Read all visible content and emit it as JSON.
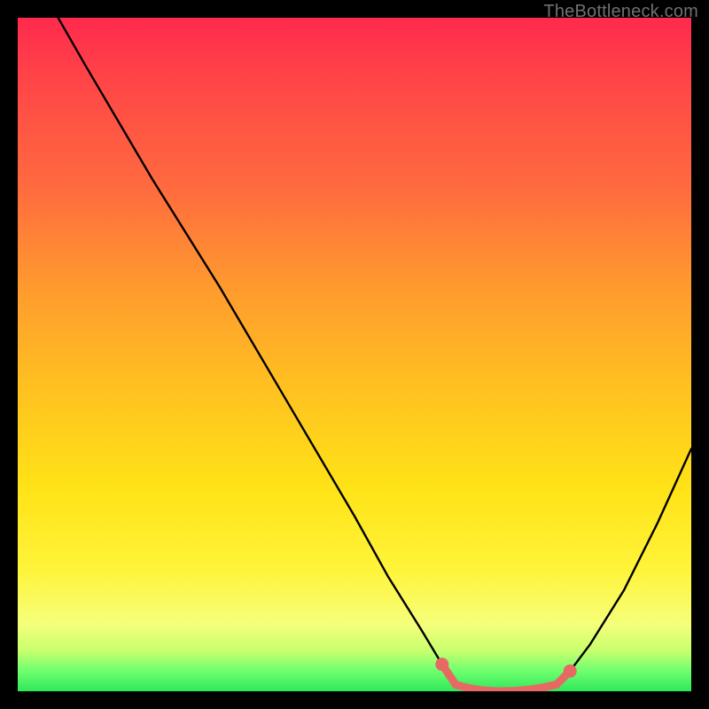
{
  "attribution": "TheBottleneck.com",
  "chart_data": {
    "type": "line",
    "title": "",
    "xlabel": "",
    "ylabel": "",
    "xlim": [
      0,
      100
    ],
    "ylim": [
      0,
      100
    ],
    "background_gradient": {
      "direction": "vertical",
      "stops": [
        {
          "pos": 0,
          "color": "#ff2a4d"
        },
        {
          "pos": 10,
          "color": "#ff4747"
        },
        {
          "pos": 25,
          "color": "#ff6a3f"
        },
        {
          "pos": 40,
          "color": "#ff9a2e"
        },
        {
          "pos": 55,
          "color": "#ffc120"
        },
        {
          "pos": 70,
          "color": "#ffe317"
        },
        {
          "pos": 82,
          "color": "#fff43a"
        },
        {
          "pos": 90,
          "color": "#f5ff7a"
        },
        {
          "pos": 94,
          "color": "#c8ff6e"
        },
        {
          "pos": 97,
          "color": "#6eff6e"
        },
        {
          "pos": 100,
          "color": "#2fe85a"
        }
      ]
    },
    "series": [
      {
        "name": "bottleneck-curve",
        "color": "#000000",
        "x": [
          6,
          10,
          20,
          30,
          40,
          50,
          55,
          60,
          63,
          65,
          68,
          72,
          76,
          80,
          82,
          85,
          90,
          95,
          100
        ],
        "y": [
          100,
          93,
          76,
          60,
          43,
          26,
          17,
          9,
          4,
          1,
          0,
          0,
          0,
          1,
          3,
          7,
          15,
          25,
          36
        ]
      },
      {
        "name": "highlight-segment",
        "color": "#e66a63",
        "x": [
          63,
          65,
          68,
          72,
          76,
          80,
          82
        ],
        "y": [
          4,
          1,
          0,
          0,
          0,
          1,
          3
        ]
      }
    ],
    "highlight_endpoints": {
      "color": "#e66a63",
      "points": [
        {
          "x": 63,
          "y": 4
        },
        {
          "x": 82,
          "y": 3
        }
      ]
    }
  }
}
